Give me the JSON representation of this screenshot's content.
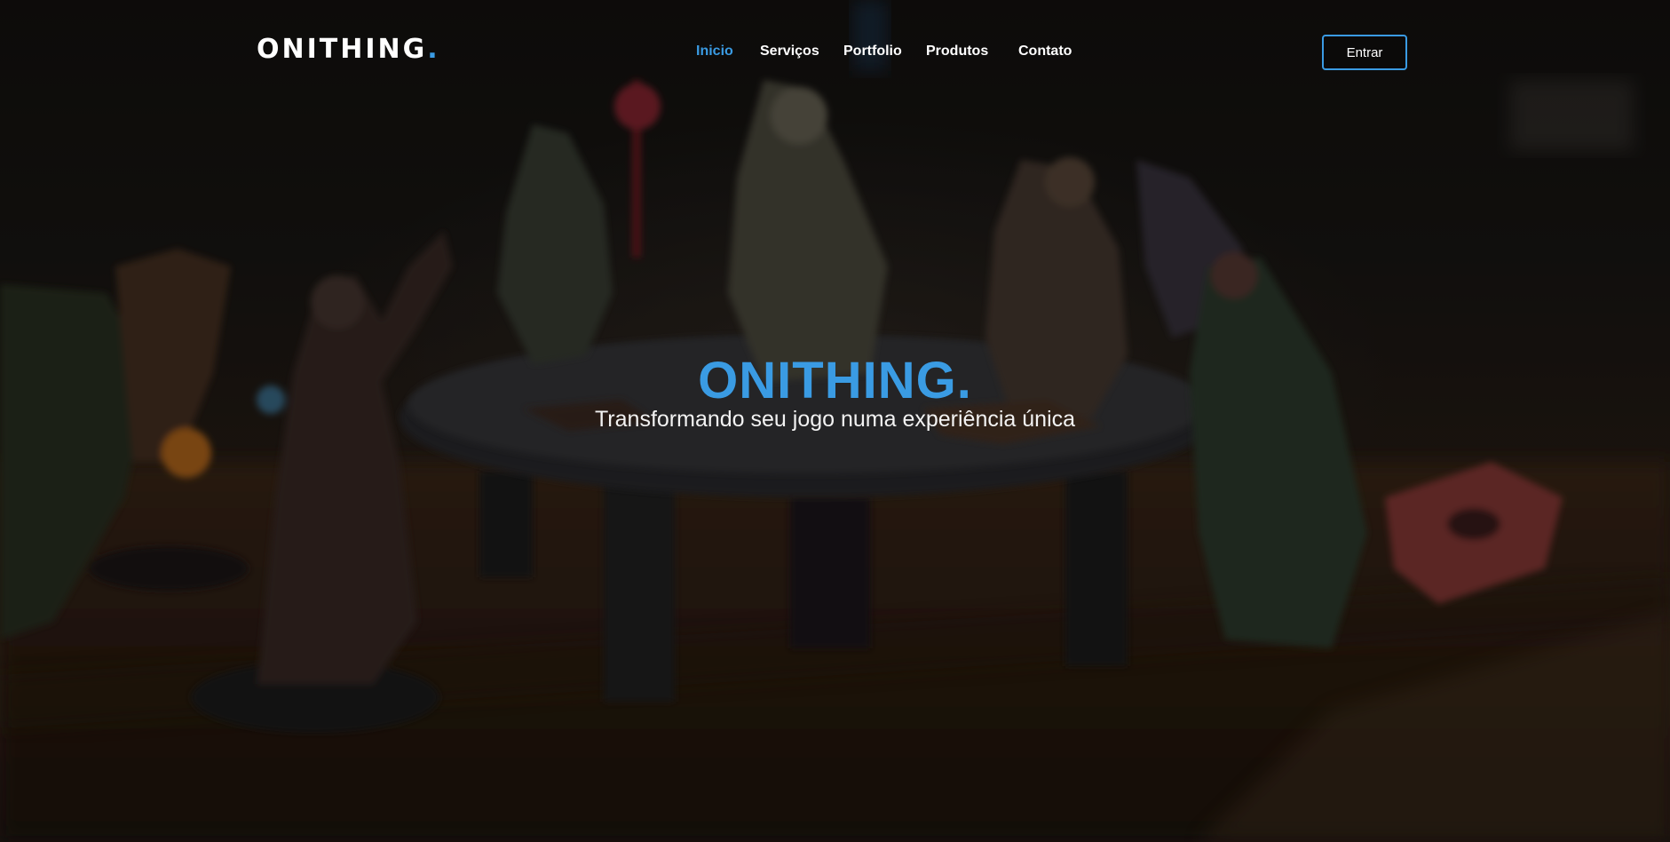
{
  "brand": {
    "logo_text": "ONITHING",
    "logo_dot": ".",
    "accent_color": "#3a9be3"
  },
  "nav": {
    "items": [
      {
        "label": "Inicio",
        "active": true
      },
      {
        "label": "Serviços",
        "active": false
      },
      {
        "label": "Portfolio",
        "active": false
      },
      {
        "label": "Produtos",
        "active": false
      },
      {
        "label": "Contato",
        "active": false
      }
    ],
    "login_label": "Entrar"
  },
  "hero": {
    "title": "ONITHING.",
    "subtitle": "Transformando seu jogo numa experiência única",
    "background": "blurred photo of fantasy miniature figures around a round table"
  }
}
